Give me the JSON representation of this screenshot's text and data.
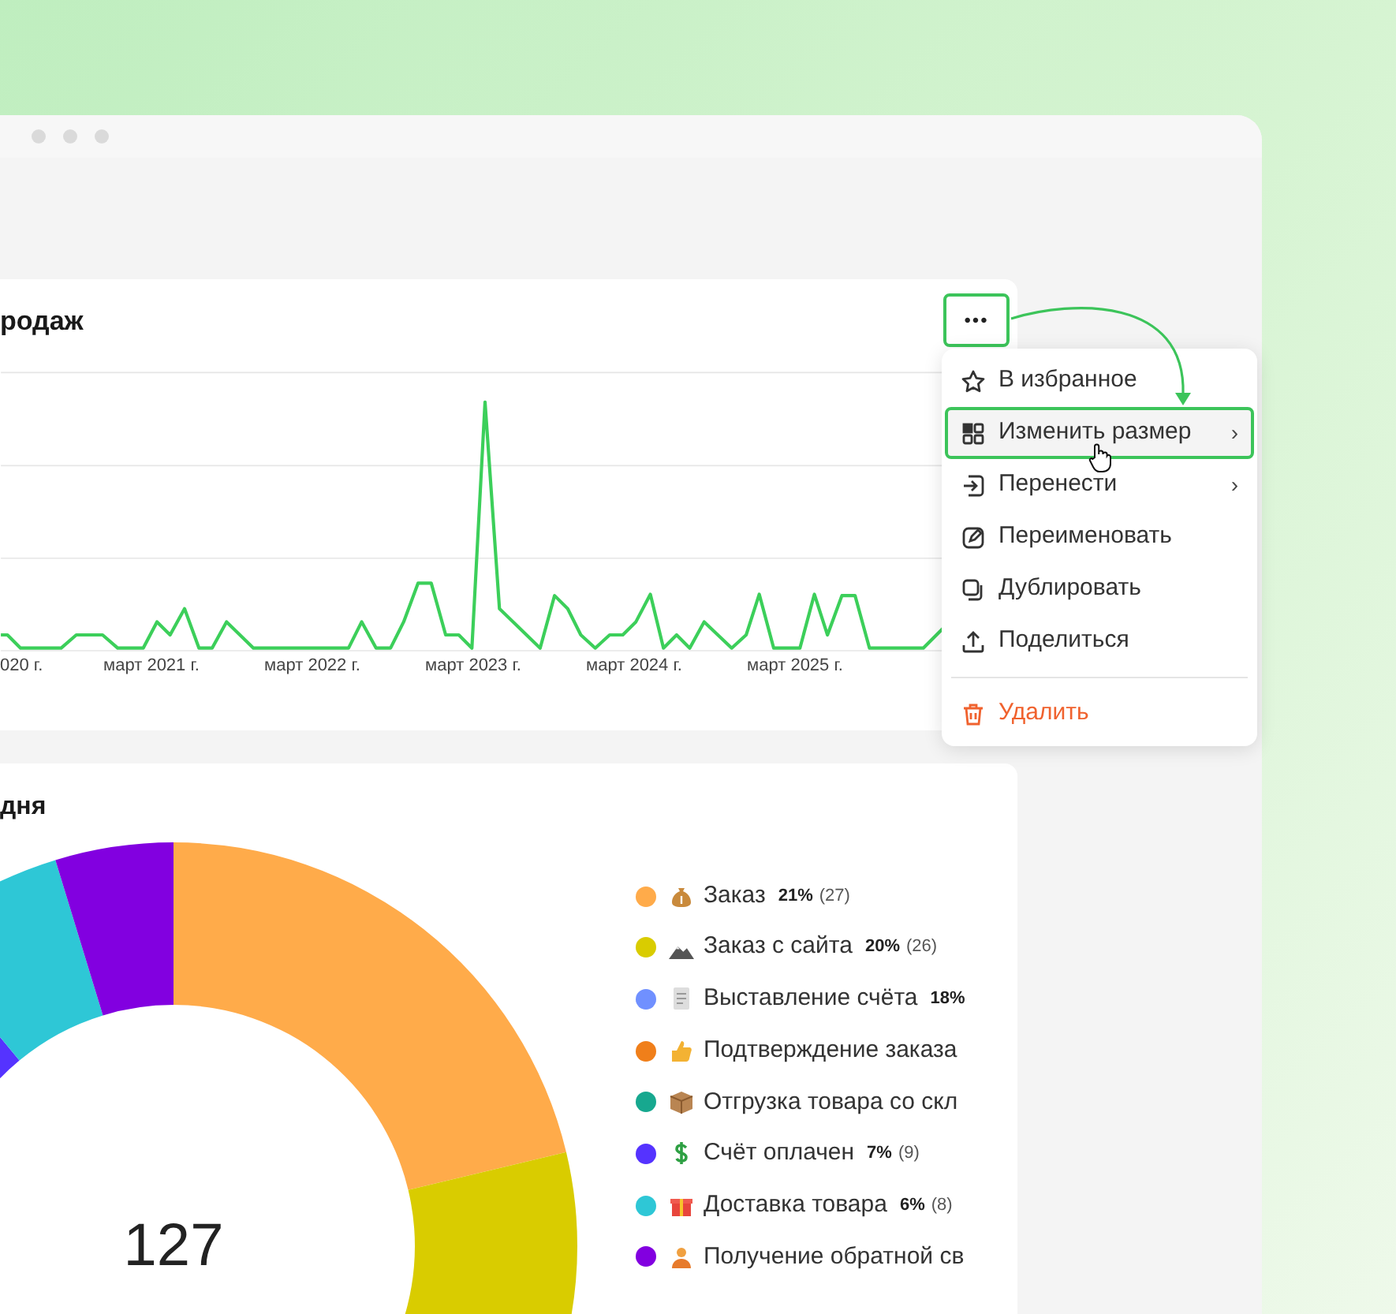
{
  "sales_card": {
    "title": "родаж",
    "x_labels": [
      "020 г.",
      "март 2021 г.",
      "март 2022 г.",
      "март 2023 г.",
      "март 2024 г.",
      "март 2025 г."
    ]
  },
  "menu_button": {
    "label": "•••",
    "highlighted": true
  },
  "menu": {
    "items": [
      {
        "label": "В избранное",
        "kind": "star",
        "highlighted": false
      },
      {
        "label": "Изменить размер",
        "kind": "grid",
        "chevron": "›",
        "highlighted": true
      },
      {
        "label": "Перенести",
        "kind": "move",
        "chevron": "›",
        "highlighted": false
      },
      {
        "label": "Переименовать",
        "kind": "edit",
        "highlighted": false
      },
      {
        "label": "Дублировать",
        "kind": "copy",
        "highlighted": false
      },
      {
        "label": "Поделиться",
        "kind": "share",
        "highlighted": false
      }
    ],
    "danger_item": {
      "label": "Удалить"
    }
  },
  "stages_card": {
    "title": "дня",
    "total": "127",
    "legend": [
      {
        "name": "Заказ",
        "color": "#ffab4a",
        "share": "21%",
        "count": "(27)"
      },
      {
        "name": "Заказ с сайта",
        "color": "#d9cc00",
        "share": "20%",
        "count": "(26)"
      },
      {
        "name": "Выставление счёта",
        "color": "#7090ff",
        "share": "18%"
      },
      {
        "name": "Подтверждение заказа",
        "color": "#f07f1a"
      },
      {
        "name": "Отгрузка товара со скл",
        "color": "#17a88f"
      },
      {
        "name": "Счёт оплачен",
        "color": "#5533ff",
        "share": "7%",
        "count": "(9)"
      },
      {
        "name": "Доставка товара",
        "color": "#2ec7d6",
        "share": "6%",
        "count": "(8)"
      },
      {
        "name": "Получение обратной св",
        "color": "#8200e0"
      }
    ]
  }
}
